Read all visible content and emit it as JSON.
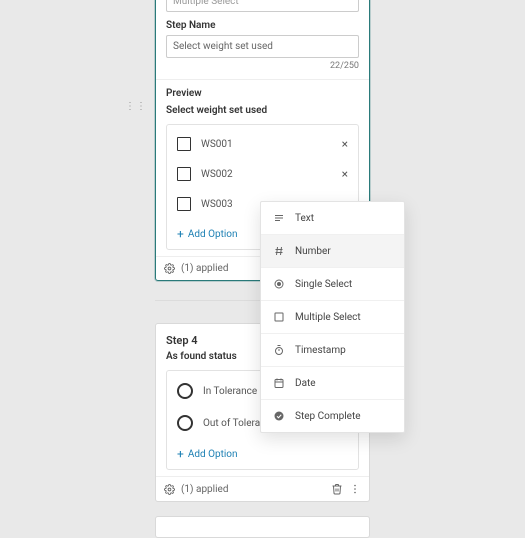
{
  "step3": {
    "type_label": "Multiple Select",
    "name_label": "Step Name",
    "name_value": "Select weight set used",
    "counter": "22/250",
    "preview_label": "Preview",
    "question": "Select weight set used",
    "options": [
      "WS001",
      "WS002",
      "WS003"
    ],
    "add_option": "Add Option",
    "applied": "(1) applied"
  },
  "step4": {
    "title": "Step 4",
    "question": "As found status",
    "options": [
      "In Tolerance",
      "Out of Tolerance"
    ],
    "add_option": "Add Option",
    "applied": "(1) applied"
  },
  "menu": {
    "items": [
      {
        "icon": "text",
        "label": "Text"
      },
      {
        "icon": "number",
        "label": "Number",
        "hover": true
      },
      {
        "icon": "single",
        "label": "Single Select"
      },
      {
        "icon": "multiple",
        "label": "Multiple Select"
      },
      {
        "icon": "timestamp",
        "label": "Timestamp"
      },
      {
        "icon": "date",
        "label": "Date"
      },
      {
        "icon": "complete",
        "label": "Step Complete"
      }
    ]
  }
}
